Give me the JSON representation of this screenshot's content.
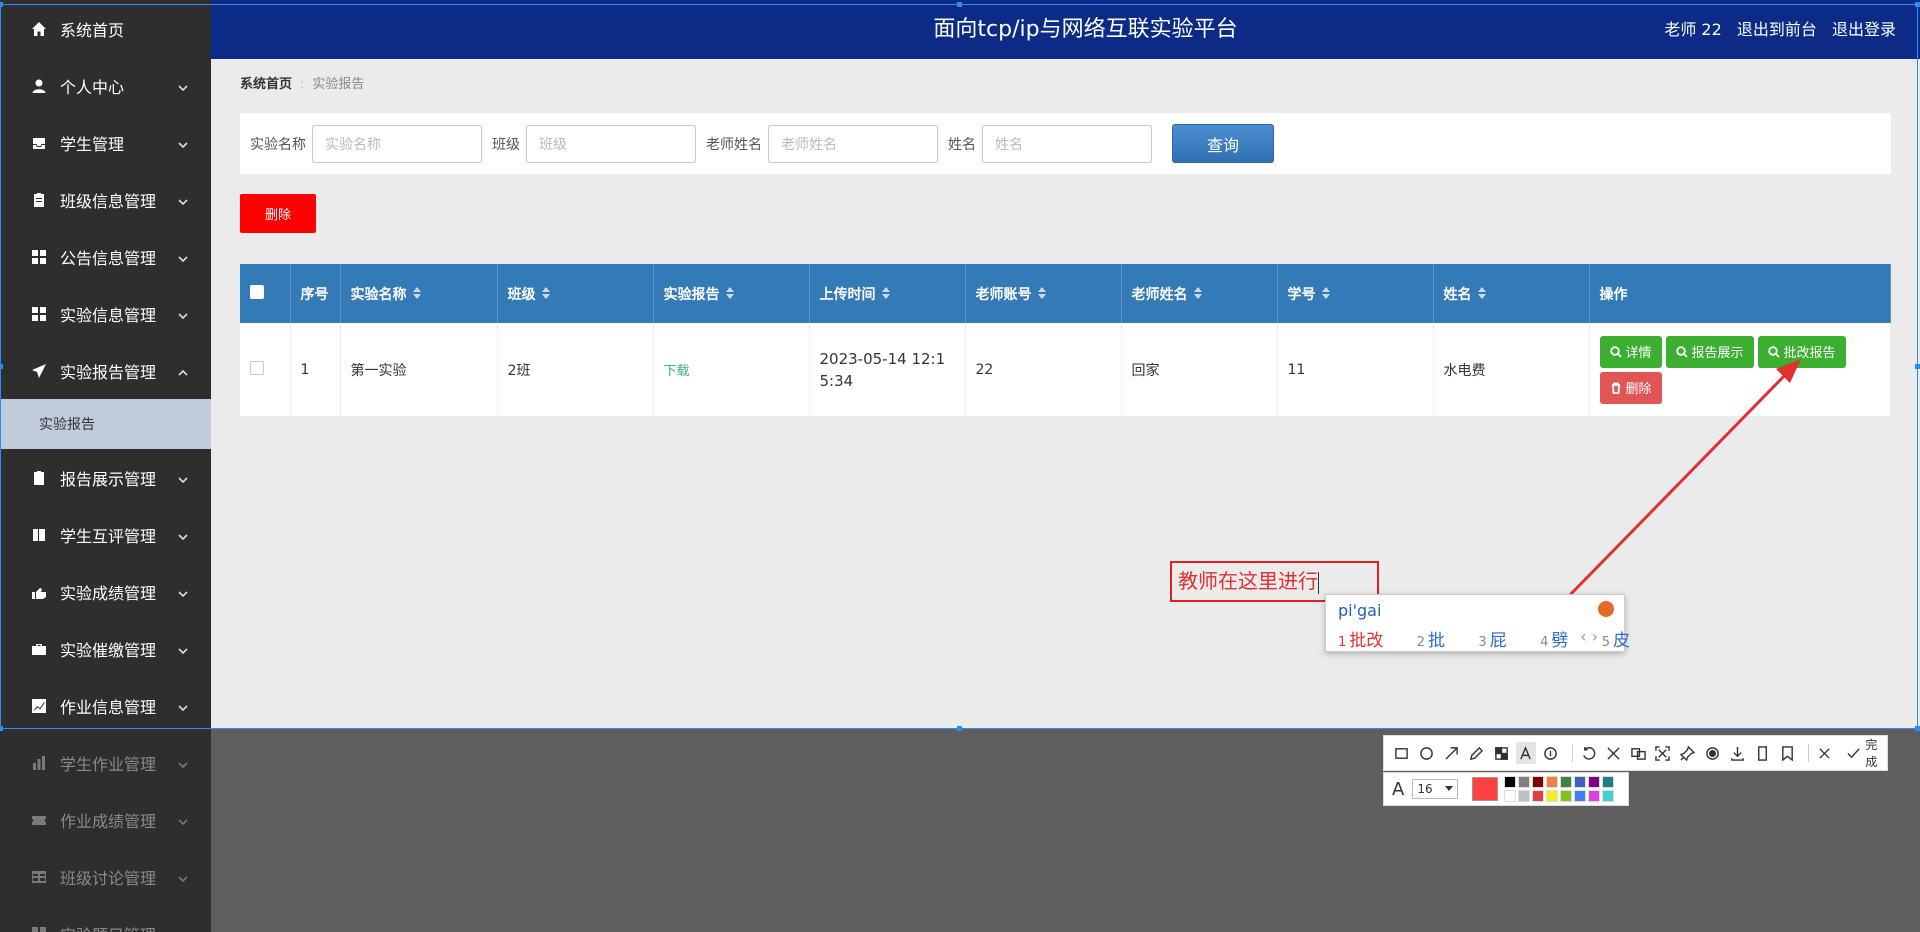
{
  "sidebar": {
    "items": [
      {
        "label": "系统首页",
        "icon": "home-icon",
        "expandable": false
      },
      {
        "label": "个人中心",
        "icon": "user-icon",
        "expandable": true
      },
      {
        "label": "学生管理",
        "icon": "inbox-icon",
        "expandable": true
      },
      {
        "label": "班级信息管理",
        "icon": "clipboard-icon",
        "expandable": true
      },
      {
        "label": "公告信息管理",
        "icon": "grid-icon",
        "expandable": true
      },
      {
        "label": "实验信息管理",
        "icon": "grid-icon",
        "expandable": true
      },
      {
        "label": "实验报告管理",
        "icon": "paper-plane-icon",
        "expandable": true,
        "expanded": true
      }
    ],
    "sub_item": "实验报告",
    "items_after": [
      {
        "label": "报告展示管理",
        "icon": "clipboard-check-icon"
      },
      {
        "label": "学生互评管理",
        "icon": "book-icon"
      },
      {
        "label": "实验成绩管理",
        "icon": "hand-icon"
      },
      {
        "label": "实验催缴管理",
        "icon": "briefcase-icon"
      },
      {
        "label": "作业信息管理",
        "icon": "line-chart-icon"
      }
    ],
    "items_dimmed": [
      {
        "label": "学生作业管理",
        "icon": "bar-chart-icon"
      },
      {
        "label": "作业成绩管理",
        "icon": "ticket-icon"
      },
      {
        "label": "班级讨论管理",
        "icon": "table-icon"
      },
      {
        "label": "实验题目管理",
        "icon": "grid-icon"
      }
    ]
  },
  "header": {
    "title": "面向tcp/ip与网络互联实验平台",
    "user": "老师 22",
    "back_link": "退出到前台",
    "logout_link": "退出登录"
  },
  "breadcrumb": {
    "home": "系统首页",
    "sep": ":",
    "current": "实验报告"
  },
  "search": {
    "fields": [
      {
        "label": "实验名称",
        "placeholder": "实验名称"
      },
      {
        "label": "班级",
        "placeholder": "班级"
      },
      {
        "label": "老师姓名",
        "placeholder": "老师姓名"
      },
      {
        "label": "姓名",
        "placeholder": "姓名"
      }
    ],
    "button": "查询"
  },
  "delete_button": "删除",
  "table": {
    "columns": [
      "序号",
      "实验名称",
      "班级",
      "实验报告",
      "上传时间",
      "老师账号",
      "老师姓名",
      "学号",
      "姓名",
      "操作"
    ],
    "rows": [
      {
        "index": "1",
        "experiment": "第一实验",
        "class": "2班",
        "report": "下载",
        "upload_time": "2023-05-14 12:15:34",
        "teacher_account": "22",
        "teacher_name": "回家",
        "student_no": "11",
        "student_name": "水电费",
        "actions": [
          "详情",
          "报告展示",
          "批改报告",
          "删除"
        ]
      }
    ]
  },
  "annotation": {
    "text": "教师在这里进行",
    "color": "#e02020"
  },
  "ime": {
    "pinyin": "pi'gai",
    "candidates": [
      {
        "num": "1",
        "text": "批改"
      },
      {
        "num": "2",
        "text": "批"
      },
      {
        "num": "3",
        "text": "屁"
      },
      {
        "num": "4",
        "text": "劈"
      },
      {
        "num": "5",
        "text": "皮"
      }
    ],
    "nav": "‹ ›"
  },
  "screenshot_toolbar": {
    "tools": [
      "rectangle-icon",
      "ellipse-icon",
      "arrow-icon",
      "pen-icon",
      "mosaic-icon",
      "text-icon",
      "number-icon",
      "undo-icon",
      "ocr-icon",
      "translate-icon",
      "scan-icon",
      "pin-icon",
      "record-icon",
      "save-icon",
      "long-shot-icon",
      "bookmark-icon",
      "close-icon"
    ],
    "done_label": "完成",
    "font_size": "16",
    "current_color": "#ff4040",
    "palette": [
      "#000000",
      "#808080",
      "#800000",
      "#f08040",
      "#408040",
      "#4060c0",
      "#800080",
      "#208080",
      "#ffffff",
      "#c0c0c0",
      "#e04040",
      "#f0f020",
      "#80c020",
      "#4080f0",
      "#e040e0",
      "#40d0d0"
    ]
  },
  "colors": {
    "header_bg": "#0b2b86",
    "sidebar_bg": "#2e2e2e",
    "table_header": "#337ab7",
    "action_green": "#3caf31",
    "action_red": "#e25555",
    "delete_red": "#ff0000"
  }
}
